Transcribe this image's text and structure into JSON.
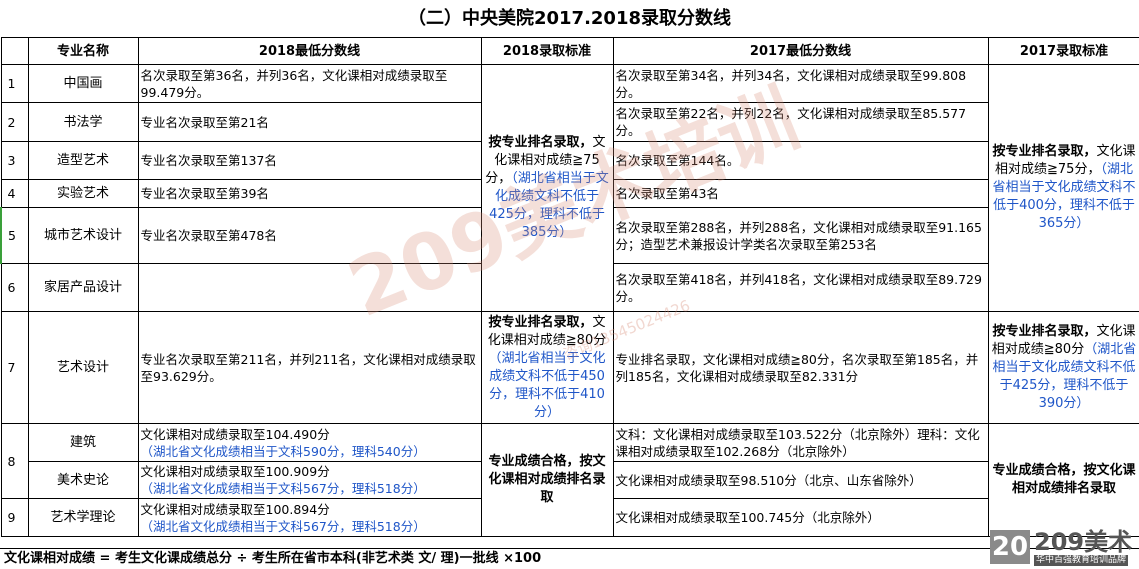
{
  "title": "（二）中央美院2017.2018录取分数线",
  "headers": [
    "",
    "专业名称",
    "2018最低分数线",
    "2018录取标准",
    "2017最低分数线",
    "2017录取标准"
  ],
  "rows": [
    {
      "num": "1",
      "name": "中国画",
      "s2018": "名次录取至第36名，并列36名，文化课相对成绩录取至99.479分。",
      "s2017": "名次录取至第34名，并列34名，文化课相对成绩录取至99.808分。"
    },
    {
      "num": "2",
      "name": "书法学",
      "s2018": "专业名次录取至第21名",
      "s2017": "名次录取至第22名，并列22名，文化课相对成绩录取至85.577分。"
    },
    {
      "num": "3",
      "name": "造型艺术",
      "s2018": "专业名次录取至第137名",
      "s2017": "名次录取至第144名。"
    },
    {
      "num": "4",
      "name": "实验艺术",
      "s2018": "专业名次录取至第39名",
      "s2017": "名次录取至第43名"
    },
    {
      "num": "5",
      "name": "城市艺术设计",
      "s2018": "专业名次录取至第478名",
      "s2017": "名次录取至第288名，并列288名，文化课相对成绩录取至91.165分；造型艺术兼报设计学类名次录取至第253名"
    },
    {
      "num": "6",
      "name": "家居产品设计",
      "s2018": "",
      "s2017": "名次录取至第418名，并列418名，文化课相对成绩录取至89.729分。"
    },
    {
      "num": "7",
      "name": "艺术设计",
      "s2018": "专业名次录取至第211名，并列211名，文化课相对成绩录取至93.629分。",
      "s2017": "专业排名录取，文化课相对成绩≧80分，名次录取至第185名，并列185名，文化课相对成绩录取至82.331分"
    },
    {
      "num": "8",
      "name": "建筑",
      "s2018a": "文化课相对成绩录取至104.490分",
      "s2018b": "（湖北省文化成绩相当于文科590分，理科540分）",
      "s2017": "文科：文化课相对成绩录取至103.522分（北京除外）理科：文化课相对成绩录取至102.268分（北京除外）"
    },
    {
      "num": "",
      "name": "美术史论",
      "s2018a": "文化课相对成绩录取至100.909分",
      "s2018b": "（湖北省文化成绩相当于文科567分，理科518分）",
      "s2017": "文化课相对成绩录取至98.510分（北京、山东省除外）"
    },
    {
      "num": "9",
      "name": "艺术学理论",
      "s2018a": "文化课相对成绩录取至100.894分",
      "s2018b": "（湖北省文化成绩相当于文科567分，理科518分）",
      "s2017": "文化课相对成绩录取至100.745分（北京除外）"
    }
  ],
  "std2018_a": {
    "bold": "按专业排名录取，",
    "plain": "文化课相对成绩≧75分，",
    "blue": "（湖北省相当于文化成绩文科不低于425分，理科不低于385分）"
  },
  "std2018_b": {
    "bold": "按专业排名录取，",
    "plain": "文化课相对成绩≧80分",
    "blue": "（湖北省相当于文化成绩文科不低于450分，理科不低于410分）"
  },
  "std2018_c": {
    "bold": "专业成绩合格，按文化课相对成绩排名录取"
  },
  "std2017_a": {
    "bold": "按专业排名录取，",
    "plain": "文化课相对成绩≧75分，",
    "blue": "（湖北省相当于文化成绩文科不低于400分，理科不低于365分）"
  },
  "std2017_b": {
    "bold": "按专业排名录取，",
    "plain": "文化课相对成绩≧80分",
    "blue": "（湖北省相当于文化成绩文科不低于425分，理科不低于390分）"
  },
  "std2017_c": {
    "bold": "专业成绩合格，按文化课相对成绩排名录取"
  },
  "footer": "文化课相对成绩 = 考生文化课成绩总分 ÷ 考生所在省市本科(非艺术类 文/ 理)一批线 ×100",
  "watermark": "209美术培训",
  "watermark_phone": "咨询13545024426",
  "logo": {
    "box": "20",
    "brand": "209美术",
    "tag": "华中百强教育培训品牌"
  }
}
